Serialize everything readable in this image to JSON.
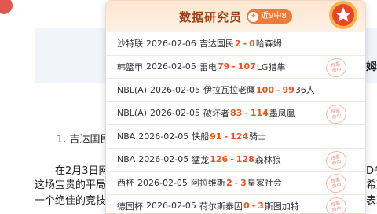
{
  "panel": {
    "title": "数据研究员",
    "streak": "近9中8",
    "stamp_text": [
      "惊喜",
      "命中"
    ]
  },
  "matches": [
    {
      "league": "沙特联",
      "date": "2026-02-06",
      "home": "吉达国民",
      "home_score": "2",
      "away_score": "0",
      "away": "哈森姆",
      "hit": false
    },
    {
      "league": "韩篮甲",
      "date": "2026-02-05",
      "home": "雷电",
      "home_score": "79",
      "away_score": "107",
      "away": "LG猎隼",
      "hit": true
    },
    {
      "league": "NBL(A)",
      "date": "2026-02-05",
      "home": "伊拉瓦拉老鹰",
      "home_score": "100",
      "away_score": "99",
      "away": "36人",
      "hit": false
    },
    {
      "league": "NBL(A)",
      "date": "2026-02-05",
      "home": "破坏者",
      "home_score": "83",
      "away_score": "114",
      "away": "墨凤凰",
      "hit": true
    },
    {
      "league": "NBA",
      "date": "2026-02-05",
      "home": "快船",
      "home_score": "91",
      "away_score": "124",
      "away": "骑士",
      "hit": false
    },
    {
      "league": "NBA",
      "date": "2026-02-05",
      "home": "猛龙",
      "home_score": "126",
      "away_score": "128",
      "away": "森林狼",
      "hit": true
    },
    {
      "league": "西杯",
      "date": "2026-02-05",
      "home": "阿拉维斯",
      "home_score": "2",
      "away_score": "3",
      "away": "皇家社会",
      "hit": true
    },
    {
      "league": "德国杯",
      "date": "2026-02-05",
      "home": "荷尔斯泰因",
      "home_score": "0",
      "away_score": "3",
      "away": "斯图加特",
      "hit": true
    }
  ],
  "background": {
    "right_char": "姆",
    "list_item": "1. 吉达国民",
    "para_line1": "在2月3日网",
    "para_line2": "这场宝贵的平局",
    "para_line3": "一个绝佳的竞技",
    "right_frag1": "D争",
    "right_frag2": "希望",
    "right_frag3": "表现"
  }
}
